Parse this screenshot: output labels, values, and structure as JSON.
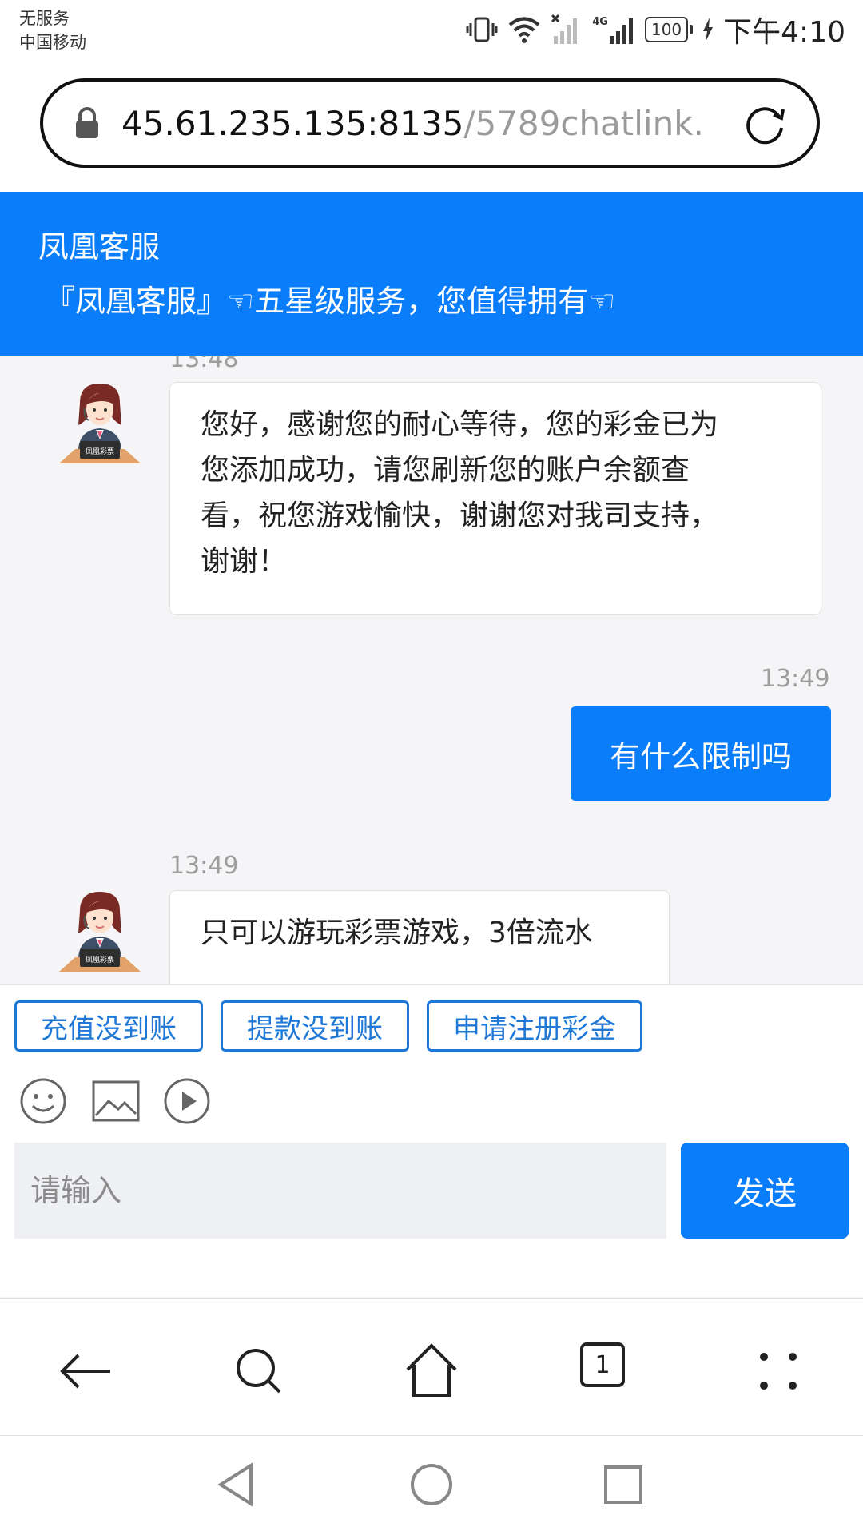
{
  "status_bar": {
    "carrier_line1": "无服务",
    "carrier_line2": "中国移动",
    "network": "4G",
    "battery": "100",
    "time": "下午4:10"
  },
  "address_bar": {
    "url_host": "45.61.235.135:8135",
    "url_path": "/5789chatlink."
  },
  "header": {
    "title": "凤凰客服",
    "subtitle": "『凤凰客服』☜五星级服务，您值得拥有☜"
  },
  "messages": [
    {
      "side": "agent",
      "time": "13:48",
      "lines": [
        "您好，感谢您的耐心等待，您的彩金已为",
        "您添加成功，请您刷新您的账户余额查",
        "看，祝您游戏愉快，谢谢您对我司支持，",
        "谢谢！"
      ]
    },
    {
      "side": "user",
      "time": "13:49",
      "text": "有什么限制吗"
    },
    {
      "side": "agent",
      "time": "13:49",
      "text": "只可以游玩彩票游戏，3倍流水"
    }
  ],
  "avatar": {
    "caption": "凤凰彩票"
  },
  "quick_replies": [
    "充值没到账",
    "提款没到账",
    "申请注册彩金"
  ],
  "toolbar_icons": [
    "emoji-icon",
    "image-icon",
    "video-icon"
  ],
  "composer": {
    "placeholder": "请输入",
    "send_label": "发送"
  },
  "browser_nav": {
    "tab_count": "1"
  },
  "colors": {
    "accent": "#0a7dfa",
    "quick_border": "#1f77d6"
  }
}
